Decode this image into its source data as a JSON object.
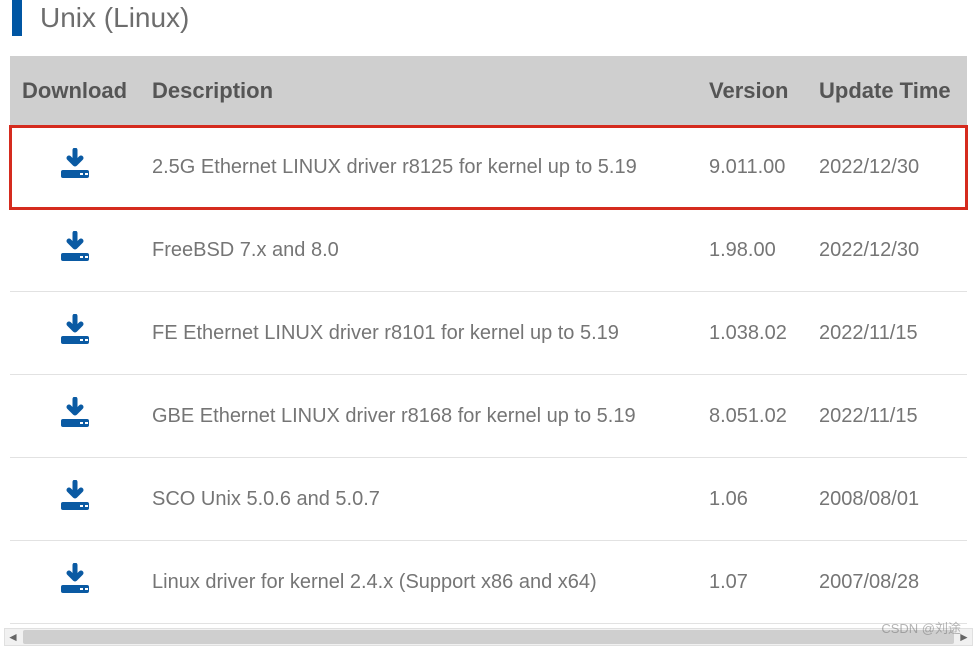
{
  "header": {
    "title": "Unix (Linux)"
  },
  "table": {
    "headers": {
      "download": "Download",
      "description": "Description",
      "version": "Version",
      "update_time": "Update Time"
    },
    "rows": [
      {
        "description": "2.5G Ethernet LINUX driver r8125 for kernel up to 5.19",
        "version": "9.011.00",
        "update_time": "2022/12/30",
        "highlighted": true
      },
      {
        "description": "FreeBSD 7.x and 8.0",
        "version": "1.98.00",
        "update_time": "2022/12/30",
        "highlighted": false
      },
      {
        "description": "FE Ethernet LINUX driver r8101 for kernel up to 5.19",
        "version": "1.038.02",
        "update_time": "2022/11/15",
        "highlighted": false
      },
      {
        "description": "GBE Ethernet LINUX driver r8168 for kernel up to 5.19",
        "version": "8.051.02",
        "update_time": "2022/11/15",
        "highlighted": false
      },
      {
        "description": "SCO Unix 5.0.6 and 5.0.7",
        "version": "1.06",
        "update_time": "2008/08/01",
        "highlighted": false
      },
      {
        "description": "Linux driver for kernel 2.4.x (Support x86 and x64)",
        "version": "1.07",
        "update_time": "2007/08/28",
        "highlighted": false
      }
    ]
  },
  "watermark": "CSDN @刘途"
}
